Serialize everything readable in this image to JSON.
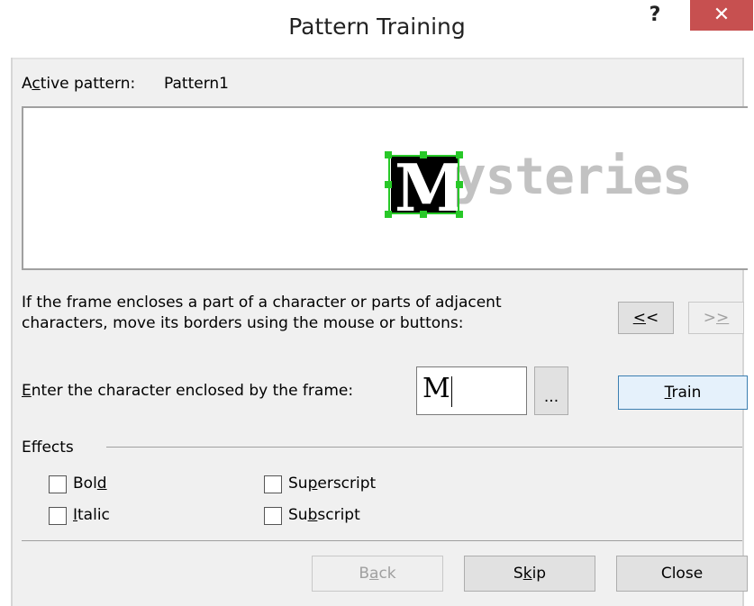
{
  "window": {
    "title": "Pattern Training",
    "help_glyph": "?",
    "close_glyph": "✕"
  },
  "active_pattern": {
    "label_pre": "A",
    "label_u": "c",
    "label_post": "tive pattern:",
    "value": "Pattern1"
  },
  "preview": {
    "framed_char": "M",
    "remaining_text": "ysteries",
    "frame_color": "#28c828"
  },
  "instructions": {
    "line1": "If the frame encloses a part of a character or parts of adjacent",
    "line2": "characters, move its borders using the mouse or buttons:"
  },
  "nav": {
    "prev_u": "<",
    "prev_rest": "<",
    "next_u": ">",
    "next_rest": ">"
  },
  "enter_char": {
    "label_u": "E",
    "label_rest": "nter the character enclosed by the frame:",
    "value": "M",
    "browse_label": "..."
  },
  "train_button": {
    "u": "T",
    "rest": "rain"
  },
  "effects": {
    "title": "Effects",
    "bold": {
      "pre": "Bol",
      "u": "d",
      "post": ""
    },
    "italic": {
      "pre": "",
      "u": "I",
      "post": "talic"
    },
    "superscript": {
      "pre": "Su",
      "u": "p",
      "post": "erscript"
    },
    "subscript": {
      "pre": "Su",
      "u": "b",
      "post": "script"
    }
  },
  "footer": {
    "back": {
      "pre": "B",
      "u": "a",
      "post": "ck"
    },
    "skip": {
      "pre": "S",
      "u": "k",
      "post": "ip"
    },
    "close": "Close"
  }
}
